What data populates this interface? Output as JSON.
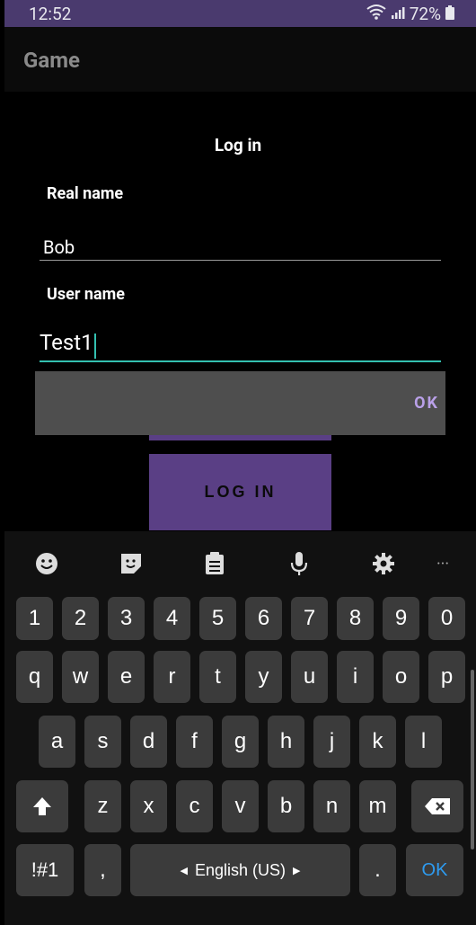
{
  "status": {
    "time": "12:52",
    "battery": "72%"
  },
  "app": {
    "title": "Game"
  },
  "form": {
    "title": "Log in",
    "real_name_label": "Real name",
    "real_name_value": "Bob",
    "user_name_label": "User name",
    "user_name_value": "Test1"
  },
  "dialog": {
    "ok_label": "OK"
  },
  "login_button": "LOG IN",
  "keyboard": {
    "numbers": [
      "1",
      "2",
      "3",
      "4",
      "5",
      "6",
      "7",
      "8",
      "9",
      "0"
    ],
    "row1": [
      "q",
      "w",
      "e",
      "r",
      "t",
      "y",
      "u",
      "i",
      "o",
      "p"
    ],
    "row2": [
      "a",
      "s",
      "d",
      "f",
      "g",
      "h",
      "j",
      "k",
      "l"
    ],
    "row3": [
      "z",
      "x",
      "c",
      "v",
      "b",
      "n",
      "m"
    ],
    "symbols_label": "!#1",
    "comma": ",",
    "space_label": "English (US)",
    "period": ".",
    "ok_label": "OK",
    "more_label": "···",
    "accent": "#2e9bf0"
  }
}
